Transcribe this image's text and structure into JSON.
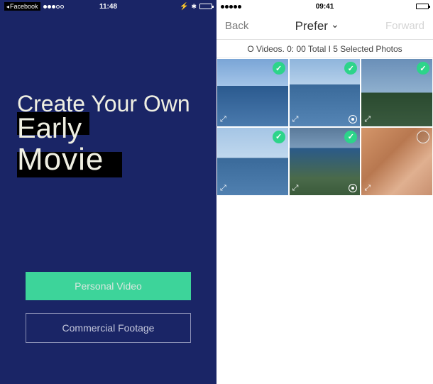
{
  "left": {
    "status": {
      "back_app": "Facebook",
      "time": "11:48"
    },
    "hero": {
      "line1": "Create Your Own",
      "line2": "Early",
      "line3": "Movie"
    },
    "buttons": {
      "primary": "Personal Video",
      "secondary": "Commercial Footage"
    }
  },
  "right": {
    "status": {
      "time": "09:41"
    },
    "nav": {
      "back": "Back",
      "title": "Prefer",
      "forward": "Forward"
    },
    "info": "O Videos. 0: 00 Total I 5 Selected Photos",
    "photos": [
      {
        "thumb": "ocean1",
        "selected": true,
        "has_video": false
      },
      {
        "thumb": "ocean2",
        "selected": true,
        "has_video": true
      },
      {
        "thumb": "palm",
        "selected": true,
        "has_video": false
      },
      {
        "thumb": "ocean3",
        "selected": true,
        "has_video": false
      },
      {
        "thumb": "ocean4",
        "selected": true,
        "has_video": true
      },
      {
        "thumb": "cat",
        "selected": false,
        "has_video": false
      }
    ]
  }
}
